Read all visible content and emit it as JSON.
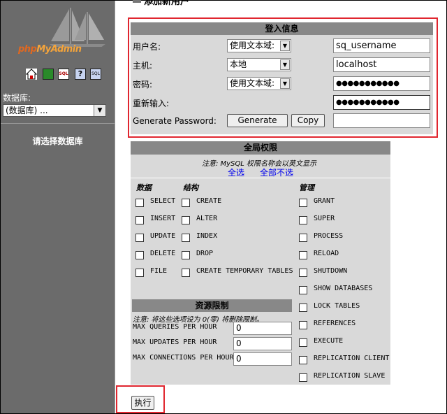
{
  "sidebar": {
    "logo": {
      "php": "php",
      "myadmin": "MyAdmin"
    },
    "icons": [
      "home-icon",
      "exit-icon",
      "sql-icon",
      "help-icon",
      "docs-icon"
    ],
    "db_label": "数据库:",
    "db_select": "(数据库) ...",
    "hint": "请选择数据库"
  },
  "page": {
    "title_partial": "添加新用户"
  },
  "login": {
    "header": "登入信息",
    "rows": [
      {
        "label": "用户名:",
        "select": "使用文本域:",
        "value": "sq_username"
      },
      {
        "label": "主机:",
        "select": "本地",
        "value": "localhost"
      },
      {
        "label": "密码:",
        "select": "使用文本域:",
        "value": "●●●●●●●●●●●"
      },
      {
        "label": "重新输入:",
        "select": "",
        "value": "●●●●●●●●●●●"
      }
    ],
    "generate_label": "Generate Password:",
    "generate_button": "Generate",
    "copy_button": "Copy",
    "generated_value": ""
  },
  "privs": {
    "header": "全局权限",
    "note": "注意: MySQL 权限名称会以英文显示",
    "select_all": "全选",
    "deselect_all": "全部不选",
    "col_data": "数据",
    "col_struct": "结构",
    "col_admin": "管理",
    "data": [
      "SELECT",
      "INSERT",
      "UPDATE",
      "DELETE",
      "FILE"
    ],
    "struct": [
      "CREATE",
      "ALTER",
      "INDEX",
      "DROP",
      "CREATE TEMPORARY TABLES"
    ],
    "admin": [
      "GRANT",
      "SUPER",
      "PROCESS",
      "RELOAD",
      "SHUTDOWN",
      "SHOW DATABASES",
      "LOCK TABLES",
      "REFERENCES",
      "EXECUTE",
      "REPLICATION CLIENT",
      "REPLICATION SLAVE"
    ]
  },
  "resources": {
    "header": "资源限制",
    "note": "注意: 将这些选项设为 0(零) 将删除限制。",
    "rows": [
      {
        "label": "MAX QUERIES PER HOUR",
        "value": "0"
      },
      {
        "label": "MAX UPDATES PER HOUR",
        "value": "0"
      },
      {
        "label": "MAX CONNECTIONS PER HOUR",
        "value": "0"
      }
    ]
  },
  "submit_button": "执行",
  "colors": {
    "highlight": "#e0262f",
    "sidebar": "#6b6b6b",
    "header": "#888888",
    "panel": "#d9d9d9"
  }
}
